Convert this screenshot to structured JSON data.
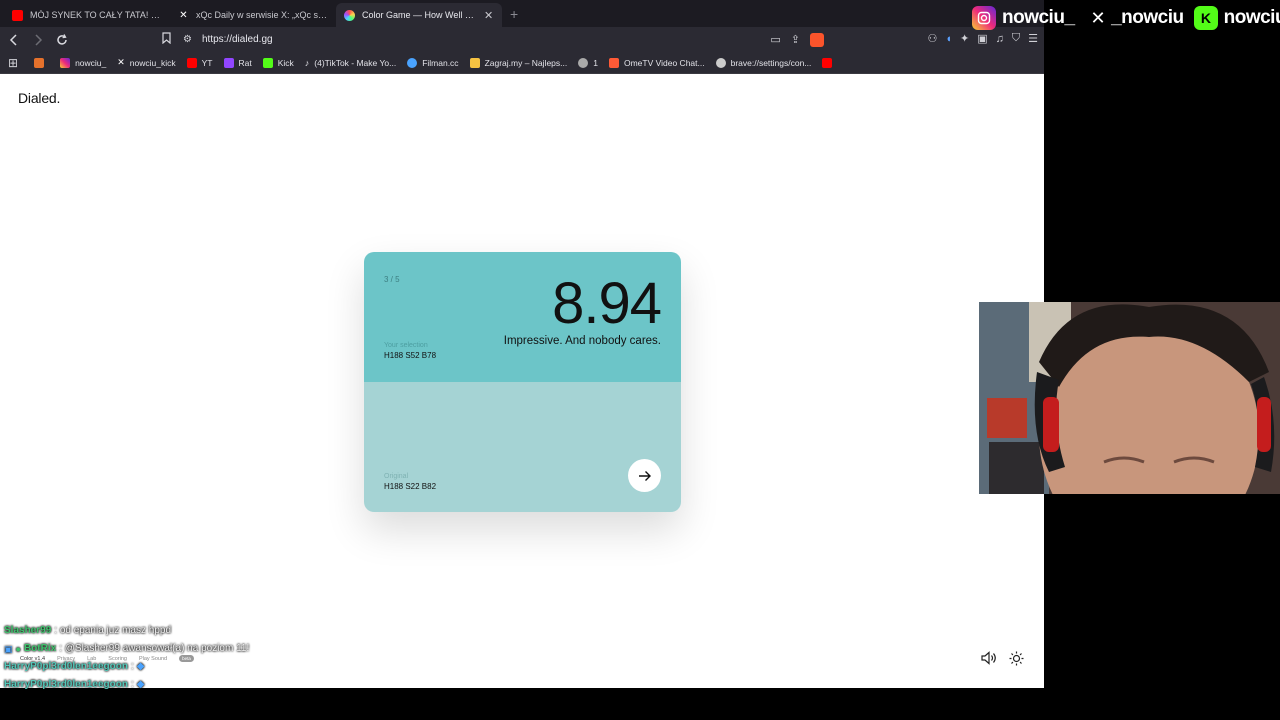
{
  "browser": {
    "tabs": [
      {
        "label": "MÓJ SYNEK TO CAŁY TATA! - YouTube",
        "active": false,
        "color": "#ff0000"
      },
      {
        "label": "xQc Daily w serwisie X: „xQc shows o",
        "active": false,
        "color": "#ffffff"
      },
      {
        "label": "Color Game — How Well Can Yo",
        "active": true,
        "color": "#ff9a3c"
      }
    ],
    "new_tab": "+",
    "url": "https://dialed.gg",
    "bookmarks": [
      {
        "label": "",
        "color": "#e5712c"
      },
      {
        "label": "nowciu_",
        "color": "#e1306c"
      },
      {
        "label": "nowciu_kick",
        "color": "#ffffff"
      },
      {
        "label": "YT",
        "color": "#ff0000"
      },
      {
        "label": "Rat",
        "color": "#9146ff"
      },
      {
        "label": "Kick",
        "color": "#53fc18"
      },
      {
        "label": "(4)TikTok - Make Yo...",
        "color": "#ffffff"
      },
      {
        "label": "Filman.cc",
        "color": "#4aa3ff"
      },
      {
        "label": "Zagraj.my – Najleps...",
        "color": "#f5c242"
      },
      {
        "label": "1",
        "color": "#aaaaaa"
      },
      {
        "label": "OmeTV Video Chat...",
        "color": "#ff5a36"
      },
      {
        "label": "brave://settings/con...",
        "color": "#cccccc"
      },
      {
        "label": "",
        "color": "#ff0000"
      }
    ]
  },
  "page": {
    "logo": "Dialed.",
    "round": "3 / 5",
    "score": "8.94",
    "feedback": "Impressive. And nobody cares.",
    "selection_label": "Your selection",
    "selection_value": "H188 S52 B78",
    "original_label": "Original",
    "original_value": "H188 S22 B82",
    "selection_color": "#6cc5c8",
    "original_color": "#a5d3d4",
    "footer": {
      "version": "Color v1.4",
      "links": [
        "Privacy",
        "Lab",
        "Scoring",
        "Play Sound"
      ],
      "beta": "beta"
    }
  },
  "chat": [
    {
      "user": "Slasher99",
      "user_color": "#3ec46d",
      "text": ": od epania juz masz hppd"
    },
    {
      "user": "BotRix",
      "user_color": "#3ec46d",
      "text": ": @Slasher99 awansował(a) na poziom 11!",
      "mention": "@Slasher99"
    },
    {
      "user": "HarryP0pl3rd0len1eegoon",
      "user_color": "#52c7b8",
      "text": ":"
    },
    {
      "user": "HarryP0pl3rd0len1eegoon",
      "user_color": "#52c7b8",
      "text": ":"
    }
  ],
  "social": {
    "instagram": "nowciu_",
    "x": "_nowciu",
    "kick": "nowciu"
  }
}
